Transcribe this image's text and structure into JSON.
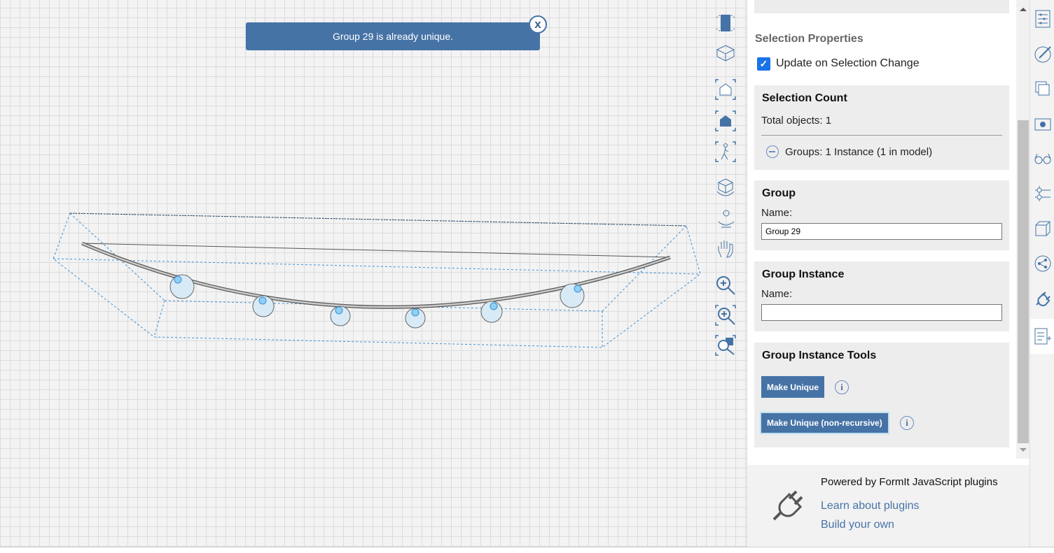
{
  "toast": {
    "message": "Group 29 is already unique.",
    "close_label": "x"
  },
  "toolbar": {
    "icons": [
      "view-cube-icon",
      "perspective-icon",
      "zoom-extents-icon",
      "zoom-selected-icon",
      "walk-icon",
      "orbit-icon",
      "look-around-icon",
      "pan-icon",
      "zoom-icon",
      "zoom-window-icon",
      "zoom-fit-icon"
    ]
  },
  "panel": {
    "title": "Selection Properties",
    "update_checkbox": {
      "label": "Update on Selection Change",
      "checked": true
    },
    "selection_count": {
      "heading": "Selection Count",
      "total": "Total objects: 1",
      "groups": "Groups: 1 Instance (1 in model)"
    },
    "group": {
      "heading": "Group",
      "name_label": "Name:",
      "name_value": "Group 29"
    },
    "group_instance": {
      "heading": "Group Instance",
      "name_label": "Name:",
      "name_value": ""
    },
    "tools": {
      "heading": "Group Instance Tools",
      "make_unique": "Make Unique",
      "make_unique_nr": "Make Unique (non-recursive)"
    },
    "footer": {
      "powered": "Powered by FormIt JavaScript plugins",
      "learn": "Learn about plugins",
      "build": "Build your own"
    }
  },
  "right_bar": {
    "icons": [
      "properties-icon",
      "materials-icon",
      "layers-icon",
      "scenes-icon",
      "visibility-icon",
      "levels-icon",
      "components-icon",
      "share-icon",
      "plugin-manager-icon",
      "properties-plugin-icon"
    ]
  },
  "colors": {
    "accent": "#4673a6",
    "checkbox": "#1a73e8"
  }
}
